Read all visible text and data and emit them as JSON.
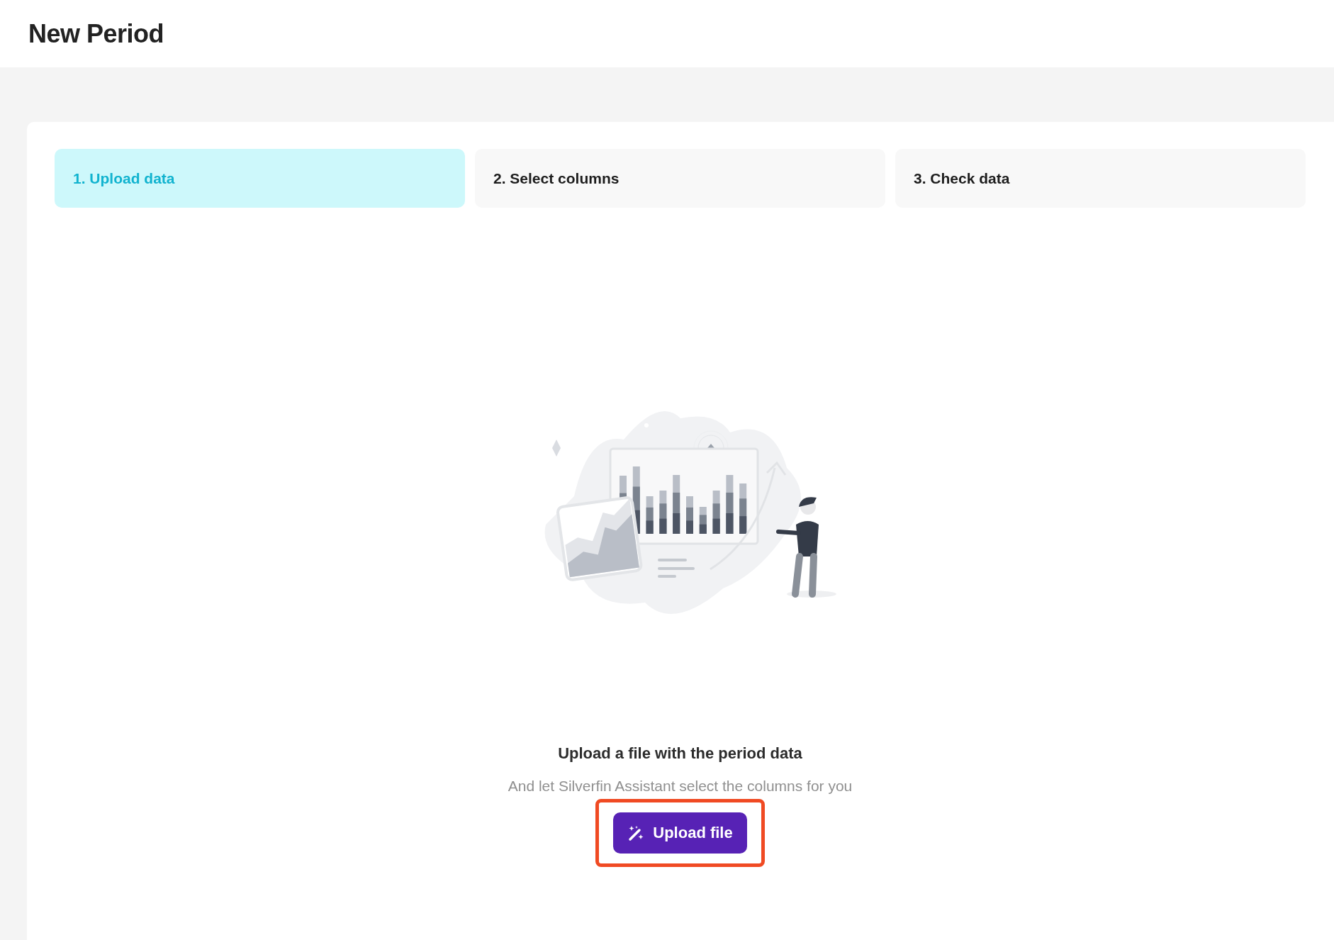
{
  "page_title": "New Period",
  "steps": [
    {
      "label": "1. Upload data",
      "selected": true
    },
    {
      "label": "2. Select columns",
      "selected": false
    },
    {
      "label": "3. Check data",
      "selected": false
    }
  ],
  "empty_state": {
    "heading": "Upload a file with the period data",
    "subtitle": "And let Silverfin Assistant select the columns for you",
    "button": {
      "label": "Upload file",
      "highlighted": true
    }
  }
}
